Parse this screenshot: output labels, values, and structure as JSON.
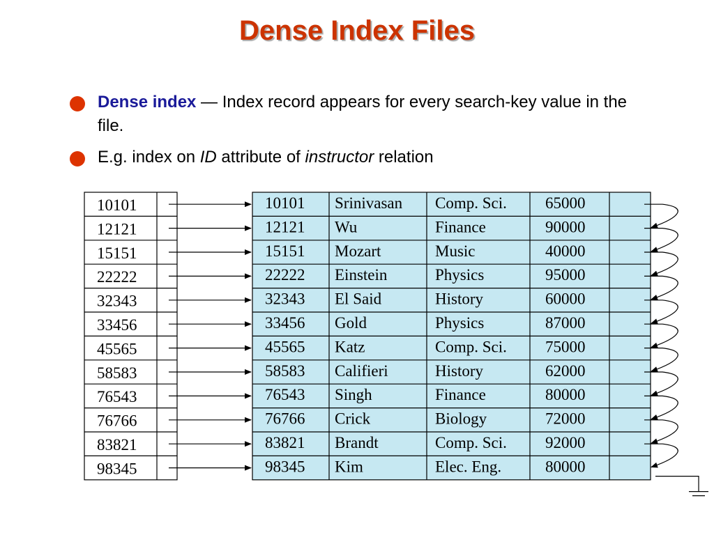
{
  "title": "Dense Index Files",
  "bullets": {
    "b1_term": "Dense index",
    "b1_rest": " — Index record appears for every search-key value in the file.",
    "b2_pre": "E.g. index on ",
    "b2_id": "ID",
    "b2_mid": " attribute of ",
    "b2_rel": "instructor",
    "b2_post": " relation"
  },
  "colors": {
    "title": "#cc3300",
    "bullet": "#dd3300",
    "term": "#1a1a99",
    "table_fill": "#c6e8f2"
  },
  "index_keys": [
    "10101",
    "12121",
    "15151",
    "22222",
    "32343",
    "33456",
    "45565",
    "58583",
    "76543",
    "76766",
    "83821",
    "98345"
  ],
  "records": [
    [
      "10101",
      "Srinivasan",
      "Comp. Sci.",
      "65000"
    ],
    [
      "12121",
      "Wu",
      "Finance",
      "90000"
    ],
    [
      "15151",
      "Mozart",
      "Music",
      "40000"
    ],
    [
      "22222",
      "Einstein",
      "Physics",
      "95000"
    ],
    [
      "32343",
      "El Said",
      "History",
      "60000"
    ],
    [
      "33456",
      "Gold",
      "Physics",
      "87000"
    ],
    [
      "45565",
      "Katz",
      "Comp. Sci.",
      "75000"
    ],
    [
      "58583",
      "Califieri",
      "History",
      "62000"
    ],
    [
      "76543",
      "Singh",
      "Finance",
      "80000"
    ],
    [
      "76766",
      "Crick",
      "Biology",
      "72000"
    ],
    [
      "83821",
      "Brandt",
      "Comp. Sci.",
      "92000"
    ],
    [
      "98345",
      "Kim",
      "Elec. Eng.",
      "80000"
    ]
  ]
}
